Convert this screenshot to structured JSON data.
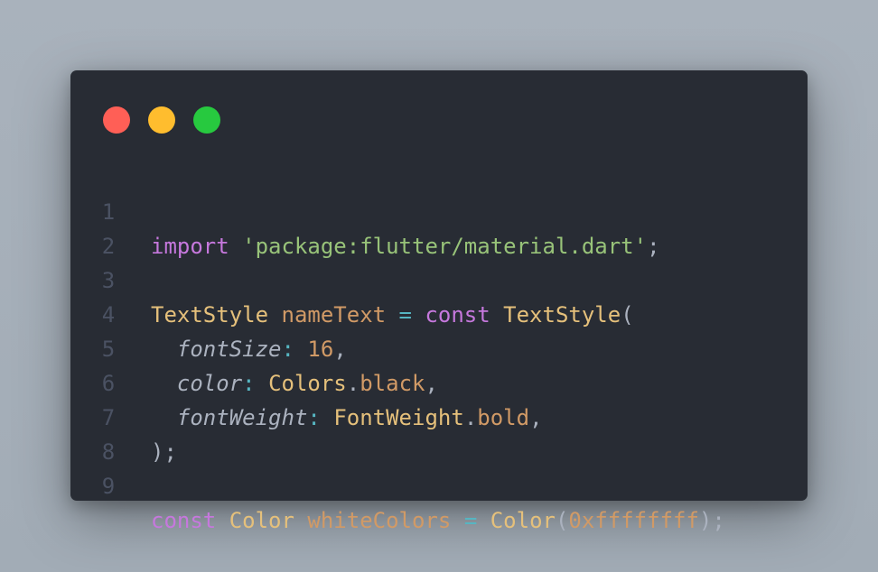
{
  "colors": {
    "background": "#a5aeb8",
    "window": "#282c34",
    "close": "#ff5f56",
    "minimize": "#ffbd2e",
    "maximize": "#27c93f"
  },
  "window_controls": [
    {
      "name": "close-button",
      "icon": "red-circle"
    },
    {
      "name": "minimize-button",
      "icon": "yellow-circle"
    },
    {
      "name": "maximize-button",
      "icon": "green-circle"
    }
  ],
  "code": {
    "line_numbers": [
      "1",
      "2",
      "3",
      "4",
      "5",
      "6",
      "7",
      "8",
      "9"
    ],
    "l1": {
      "kw": "import",
      "sp": " ",
      "str": "'package:flutter/material.dart'",
      "end": ";"
    },
    "l3": {
      "cls": "TextStyle",
      "sp1": " ",
      "var": "nameText",
      "sp2": " ",
      "op": "=",
      "sp3": " ",
      "kw": "const",
      "sp4": " ",
      "cls2": "TextStyle",
      "paren": "("
    },
    "l4": {
      "indent": "  ",
      "param": "fontSize",
      "colon": ":",
      "sp": " ",
      "num": "16",
      "comma": ","
    },
    "l5": {
      "indent": "  ",
      "param": "color",
      "colon": ":",
      "sp": " ",
      "cls": "Colors",
      "dot": ".",
      "prop": "black",
      "comma": ","
    },
    "l6": {
      "indent": "  ",
      "param": "fontWeight",
      "colon": ":",
      "sp": " ",
      "cls": "FontWeight",
      "dot": ".",
      "prop": "bold",
      "comma": ","
    },
    "l7": {
      "close": ");"
    },
    "l9": {
      "kw": "const",
      "sp1": " ",
      "cls": "Color",
      "sp2": " ",
      "var": "whiteColors",
      "sp3": " ",
      "op": "=",
      "sp4": " ",
      "cls2": "Color",
      "open": "(",
      "num": "0xffffffff",
      "close": ");"
    }
  }
}
